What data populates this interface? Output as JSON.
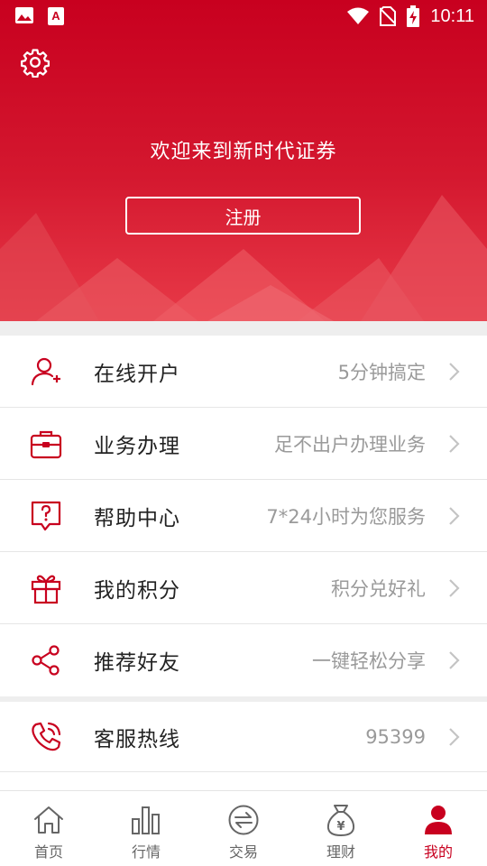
{
  "status_bar": {
    "time": "10:11",
    "left_icons": [
      "image-icon",
      "font-app-icon"
    ],
    "right_icons": [
      "wifi-icon",
      "no-sim-icon",
      "battery-charging-icon"
    ]
  },
  "header": {
    "welcome_text": "欢迎来到新时代证券",
    "register_label": "注册",
    "settings_icon": "gear-icon",
    "bg_color": "#c8001f"
  },
  "menu": {
    "items": [
      {
        "label": "在线开户",
        "value": "5分钟搞定",
        "icon": "add-user-icon"
      },
      {
        "label": "业务办理",
        "value": "足不出户办理业务",
        "icon": "briefcase-icon"
      },
      {
        "label": "帮助中心",
        "value": "7*24小时为您服务",
        "icon": "help-chat-icon"
      },
      {
        "label": "我的积分",
        "value": "积分兑好礼",
        "icon": "gift-icon"
      },
      {
        "label": "推荐好友",
        "value": "一键轻松分享",
        "icon": "share-icon"
      },
      {
        "label": "客服热线",
        "value": "95399",
        "icon": "phone-icon"
      }
    ]
  },
  "bottom_nav": {
    "items": [
      {
        "label": "首页",
        "icon": "home-icon",
        "active": false
      },
      {
        "label": "行情",
        "icon": "bar-chart-icon",
        "active": false
      },
      {
        "label": "交易",
        "icon": "exchange-icon",
        "active": false
      },
      {
        "label": "理财",
        "icon": "money-bag-icon",
        "active": false
      },
      {
        "label": "我的",
        "icon": "person-icon",
        "active": true
      }
    ]
  },
  "colors": {
    "accent": "#c8001f",
    "text_primary": "#222222",
    "text_secondary": "#9a9a9a"
  }
}
